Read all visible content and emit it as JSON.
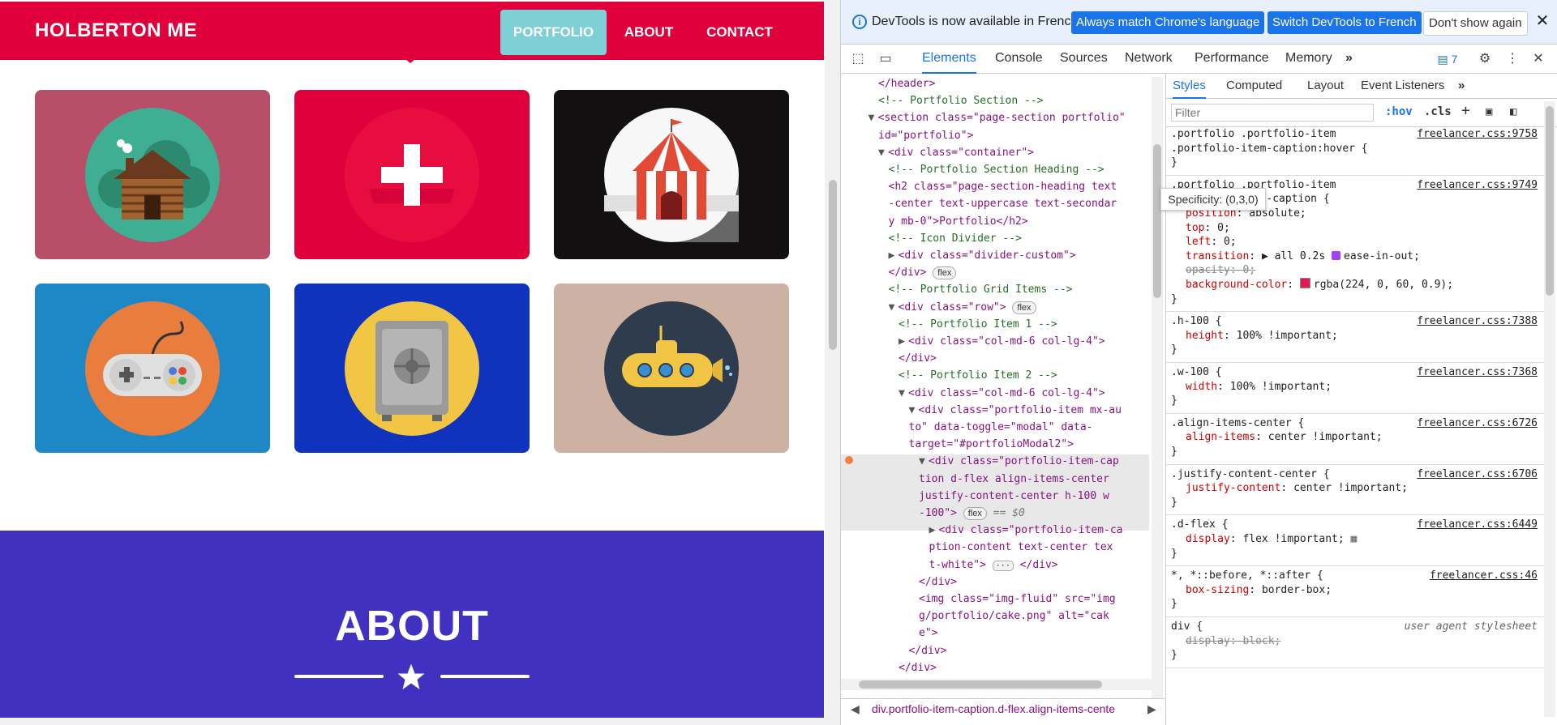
{
  "site": {
    "brand": "HOLBERTON ME",
    "nav": [
      "PORTFOLIO",
      "ABOUT",
      "CONTACT"
    ],
    "portfolio_items": [
      {
        "icon": "cabin-icon",
        "bg": "#b84e68",
        "circle": "#3fae93"
      },
      {
        "icon": "cake-icon",
        "bg": "#e0003c",
        "circle": "#e0003c"
      },
      {
        "icon": "circus-tent-icon",
        "bg": "#121011",
        "circle": "#f7f7f7"
      },
      {
        "icon": "game-controller-icon",
        "bg": "#1e87c5",
        "circle": "#e87d3e"
      },
      {
        "icon": "safe-icon",
        "bg": "#0f33bd",
        "circle": "#f1c644"
      },
      {
        "icon": "submarine-icon",
        "bg": "#cdb2a4",
        "circle": "#2f3c4d"
      }
    ],
    "about_heading": "ABOUT"
  },
  "devtools": {
    "infobar": {
      "message": "DevTools is now available in French!",
      "btn_match": "Always match Chrome's language",
      "btn_switch": "Switch DevTools to French",
      "btn_dont_show": "Don't show again",
      "close": "✕"
    },
    "tabs": [
      "Elements",
      "Console",
      "Sources",
      "Network",
      "Performance",
      "Memory"
    ],
    "tabs_more": "»",
    "issues_count": "7",
    "elements_lines": [
      {
        "indent": 4,
        "kind": "tag",
        "text": "</header>"
      },
      {
        "indent": 4,
        "kind": "cmt",
        "text": "<!-- Portfolio Section -->"
      },
      {
        "indent": 3,
        "kind": "tag",
        "tri": "▼",
        "text": "<section class=\"page-section portfolio\""
      },
      {
        "indent": 4,
        "kind": "tag",
        "text": "id=\"portfolio\">"
      },
      {
        "indent": 4,
        "kind": "tag",
        "tri": "▼",
        "text": "<div class=\"container\">"
      },
      {
        "indent": 5,
        "kind": "cmt",
        "text": "<!-- Portfolio Section Heading -->"
      },
      {
        "indent": 5,
        "kind": "tag",
        "text": "<h2 class=\"page-section-heading text"
      },
      {
        "indent": 5,
        "kind": "tag",
        "text": "-center text-uppercase text-secondar"
      },
      {
        "indent": 5,
        "kind": "tag",
        "text": "y mb-0\">Portfolio</h2>"
      },
      {
        "indent": 5,
        "kind": "cmt",
        "text": "<!-- Icon Divider -->"
      },
      {
        "indent": 5,
        "kind": "tag",
        "tri": "▶",
        "text": "<div class=\"divider-custom\">"
      },
      {
        "indent": 5,
        "kind": "tag",
        "text": "</div>",
        "pill": "flex"
      },
      {
        "indent": 5,
        "kind": "cmt",
        "text": "<!-- Portfolio Grid Items -->"
      },
      {
        "indent": 5,
        "kind": "tag",
        "tri": "▼",
        "text": "<div class=\"row\">",
        "pill": "flex"
      },
      {
        "indent": 6,
        "kind": "cmt",
        "text": "<!-- Portfolio Item 1 -->"
      },
      {
        "indent": 6,
        "kind": "tag",
        "tri": "▶",
        "text": "<div class=\"col-md-6 col-lg-4\">"
      },
      {
        "indent": 6,
        "kind": "tag",
        "text": "</div>"
      },
      {
        "indent": 6,
        "kind": "cmt",
        "text": "<!-- Portfolio Item 2 -->"
      },
      {
        "indent": 6,
        "kind": "tag",
        "tri": "▼",
        "text": "<div class=\"col-md-6 col-lg-4\">"
      },
      {
        "indent": 7,
        "kind": "tag",
        "tri": "▼",
        "text": "<div class=\"portfolio-item mx-au"
      },
      {
        "indent": 7,
        "kind": "tag",
        "text": "to\" data-toggle=\"modal\" data-"
      },
      {
        "indent": 7,
        "kind": "tag",
        "text": "target=\"#portfolioModal2\">"
      },
      {
        "indent": 8,
        "kind": "tag",
        "tri": "▼",
        "text": "<div class=\"portfolio-item-cap"
      },
      {
        "indent": 8,
        "kind": "tag",
        "text": "tion d-flex align-items-center"
      },
      {
        "indent": 8,
        "kind": "tag",
        "text": "justify-content-center h-100 w"
      },
      {
        "indent": 8,
        "kind": "tag",
        "text": "-100\">",
        "pill": "flex",
        "suffix": " == $0"
      },
      {
        "indent": 9,
        "kind": "tag",
        "tri": "▶",
        "text": "<div class=\"portfolio-item-ca"
      },
      {
        "indent": 9,
        "kind": "tag",
        "text": "ption-content text-center tex"
      },
      {
        "indent": 9,
        "kind": "tag",
        "text": "t-white\">",
        "dots": true,
        "suffix2": "</div>"
      },
      {
        "indent": 8,
        "kind": "tag",
        "text": "</div>"
      },
      {
        "indent": 8,
        "kind": "tag",
        "text": "<img class=\"img-fluid\" src=\"img"
      },
      {
        "indent": 8,
        "kind": "tag",
        "text": "g/portfolio/cake.png\" alt=\"cak"
      },
      {
        "indent": 8,
        "kind": "tag",
        "text": "e\">"
      },
      {
        "indent": 7,
        "kind": "tag",
        "text": "</div>"
      },
      {
        "indent": 6,
        "kind": "tag",
        "text": "</div>"
      }
    ],
    "breadcrumb": "div.portfolio-item-caption.d-flex.align-items-cente",
    "styles": {
      "tabs": [
        "Styles",
        "Computed",
        "Layout",
        "Event Listeners"
      ],
      "tabs_more": "»",
      "filter_placeholder": "Filter",
      "hov": ":hov",
      "cls": ".cls",
      "tooltip": "Specificity: (0,3,0)",
      "rules": [
        {
          "selector": [
            ".portfolio .portfolio-item",
            ".portfolio-item-caption:hover {"
          ],
          "source": "freelancer.css:9758",
          "props": []
        },
        {
          "selector": [
            ".portfolio .portfolio-item",
            ".portfolio-item-caption {"
          ],
          "source": "freelancer.css:9749",
          "props": [
            {
              "name": "position",
              "value": "absolute;"
            },
            {
              "name": "top",
              "value": "0;"
            },
            {
              "name": "left",
              "value": "0;"
            },
            {
              "name": "transition",
              "value": "▶ all 0.2s ",
              "easing": "ease-in-out;"
            },
            {
              "name": "opacity",
              "value": "0;",
              "struck": true
            },
            {
              "name": "background-color",
              "value": "rgba(224, 0, 60, 0.9);",
              "swatch": "#e0003c"
            }
          ]
        },
        {
          "selector": [
            ".h-100 {"
          ],
          "source": "freelancer.css:7388",
          "props": [
            {
              "name": "height",
              "value": "100% !important;"
            }
          ]
        },
        {
          "selector": [
            ".w-100 {"
          ],
          "source": "freelancer.css:7368",
          "props": [
            {
              "name": "width",
              "value": "100% !important;"
            }
          ]
        },
        {
          "selector": [
            ".align-items-center {"
          ],
          "source": "freelancer.css:6726",
          "props": [
            {
              "name": "align-items",
              "value": "center !important;"
            }
          ]
        },
        {
          "selector": [
            ".justify-content-center {"
          ],
          "source": "freelancer.css:6706",
          "props": [
            {
              "name": "justify-content",
              "value": "center !important;"
            }
          ]
        },
        {
          "selector": [
            ".d-flex {"
          ],
          "source": "freelancer.css:6449",
          "props": [
            {
              "name": "display",
              "value": "flex !important;"
            }
          ]
        },
        {
          "selector": [
            "*, *::before, *::after {"
          ],
          "source": "freelancer.css:46",
          "props": [
            {
              "name": "box-sizing",
              "value": "border-box;"
            }
          ]
        },
        {
          "selector": [
            "div {"
          ],
          "source": "user agent stylesheet",
          "ua": true,
          "props": [
            {
              "name": "display",
              "value": "block;",
              "struck": true
            }
          ]
        }
      ]
    }
  }
}
